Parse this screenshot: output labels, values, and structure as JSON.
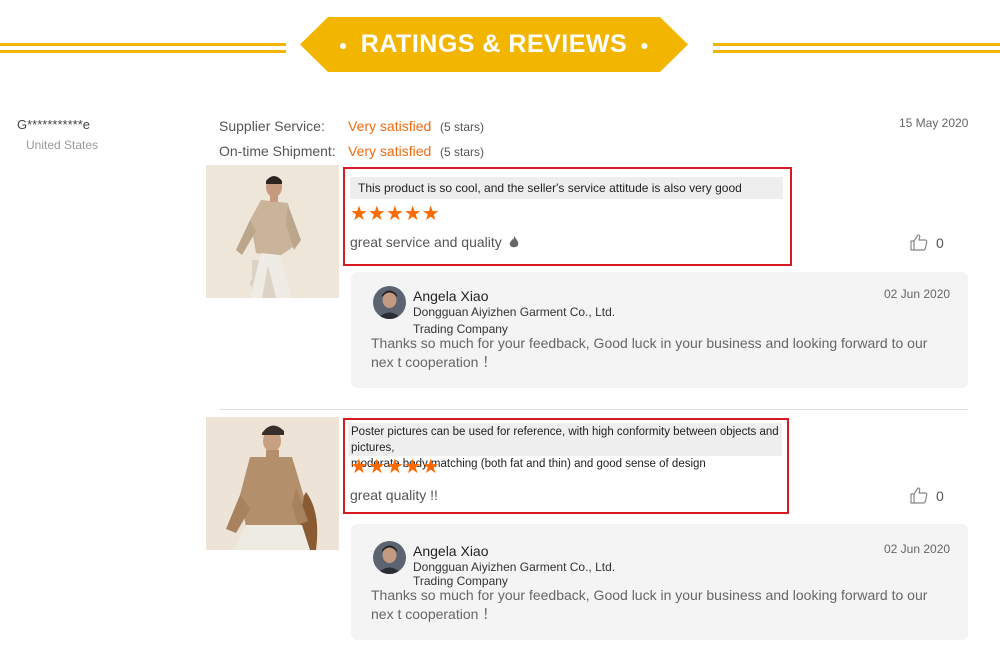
{
  "header": {
    "title": "RATINGS & REVIEWS",
    "dot": "●",
    "accent_color": "#f3b600"
  },
  "reviewer": {
    "name": "G***********e",
    "country": "United States"
  },
  "ratings": [
    {
      "label": "Supplier Service:",
      "value": "Very satisfied",
      "stars_text": "(5 stars)"
    },
    {
      "label": "On-time Shipment:",
      "value": "Very satisfied",
      "stars_text": "(5 stars)"
    }
  ],
  "review_date": "15 May 2020",
  "reviews": [
    {
      "headline": "This product is so cool, and the seller's service attitude is also very good",
      "stars": "★★★★★",
      "rating": 5,
      "comment": "great service and quality",
      "like_count": "0",
      "reply": {
        "name": "Angela Xiao",
        "company": "Dongguan Aiyizhen Garment Co., Ltd.",
        "type": "Trading Company",
        "date": "02 Jun 2020",
        "text": "Thanks so much for your feedback, Good luck in your business and looking forward to our nex t cooperation ！"
      }
    },
    {
      "headline_line1": "Poster pictures can be used for reference, with high conformity between objects and pictures,",
      "headline_line2": "moderate body matching (both fat and thin) and good sense of design",
      "stars": "★★★★★",
      "rating": 5,
      "comment": "great quality !!",
      "like_count": "0",
      "reply": {
        "name": "Angela Xiao",
        "company": "Dongguan Aiyizhen Garment Co., Ltd.",
        "type": "Trading Company",
        "date": "02 Jun 2020",
        "text": "Thanks so much for your feedback, Good luck in your business and looking forward to our nex t cooperation ！"
      }
    }
  ],
  "icons": {
    "like": "thumbs-up-icon",
    "emoji": "fire-icon"
  },
  "colors": {
    "highlight_border": "#d71921",
    "star": "#ff6a00",
    "satisfied": "#f06a10"
  }
}
